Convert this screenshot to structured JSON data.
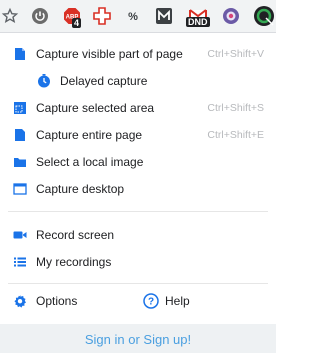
{
  "toolbar": {
    "icons": [
      {
        "name": "star-icon"
      },
      {
        "name": "power-icon"
      },
      {
        "name": "adblock-icon",
        "badge": "4"
      },
      {
        "name": "first-aid-icon"
      },
      {
        "name": "percent-icon"
      },
      {
        "name": "m-logo-icon"
      },
      {
        "name": "gmail-icon",
        "badge": "DND"
      },
      {
        "name": "shield-extension-icon"
      },
      {
        "name": "screen-capture-extension-icon"
      }
    ]
  },
  "menu": {
    "capture_visible": {
      "label": "Capture visible part of page",
      "shortcut": "Ctrl+Shift+V"
    },
    "delayed_capture": {
      "label": "Delayed capture"
    },
    "capture_selected": {
      "label": "Capture selected area",
      "shortcut": "Ctrl+Shift+S"
    },
    "capture_entire": {
      "label": "Capture entire page",
      "shortcut": "Ctrl+Shift+E"
    },
    "select_local": {
      "label": "Select a local image"
    },
    "capture_desktop": {
      "label": "Capture desktop"
    },
    "record_screen": {
      "label": "Record screen"
    },
    "my_recordings": {
      "label": "My recordings"
    },
    "options": {
      "label": "Options"
    },
    "help": {
      "label": "Help"
    }
  },
  "footer": {
    "signin_label": "Sign in or Sign up!"
  },
  "colors": {
    "accent_blue": "#1a73e8",
    "link_blue": "#4a9fe0",
    "shortcut_gray": "#b7b9bc"
  }
}
